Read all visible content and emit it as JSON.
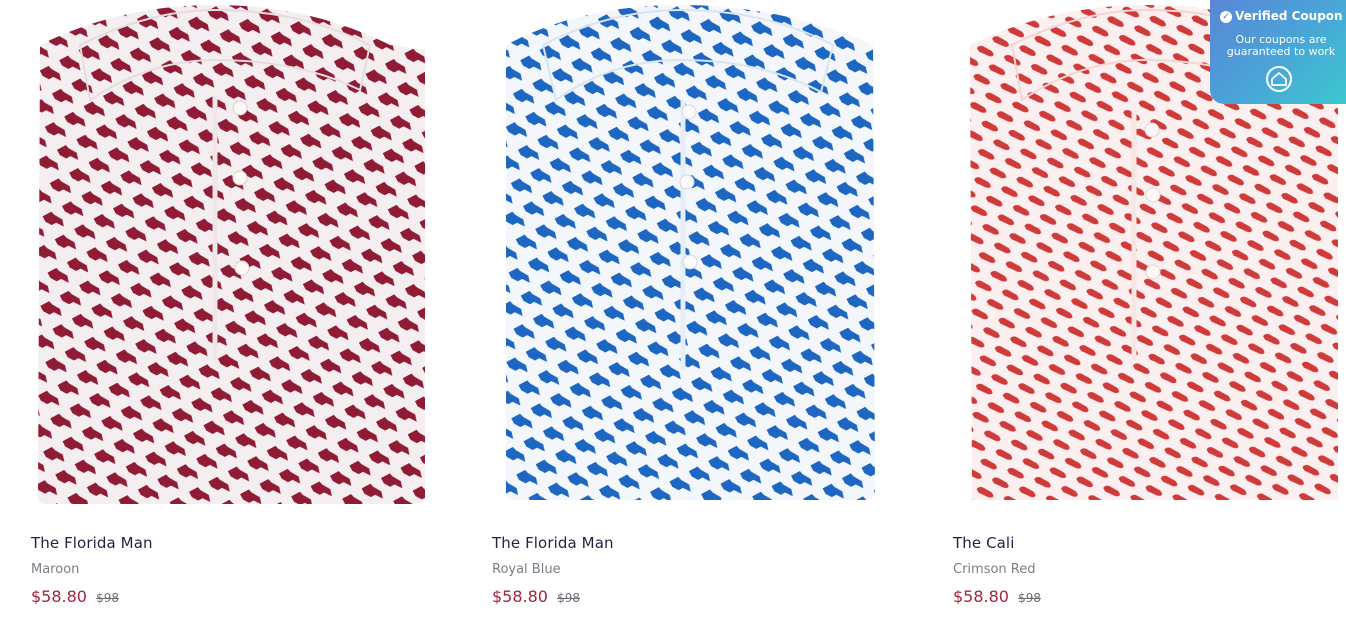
{
  "products": [
    {
      "title": "The Florida Man",
      "color": "Maroon",
      "sale_price": "$58.80",
      "original_price": "$98",
      "swatch_color": "#8f1c34",
      "image_icon": "polo-shirt-icon"
    },
    {
      "title": "The Florida Man",
      "color": "Royal Blue",
      "sale_price": "$58.80",
      "original_price": "$98",
      "swatch_color": "#1d67c2",
      "image_icon": "polo-shirt-icon"
    },
    {
      "title": "The Cali",
      "color": "Crimson Red",
      "sale_price": "$58.80",
      "original_price": "$98",
      "swatch_color": "#cf3a3a",
      "image_icon": "polo-shirt-icon"
    }
  ],
  "coupon_badge": {
    "title": "Verified Coupon",
    "subtitle": "Our coupons are guaranteed to work",
    "icons": [
      "check-circle-icon",
      "coupon-logo-icon"
    ]
  }
}
